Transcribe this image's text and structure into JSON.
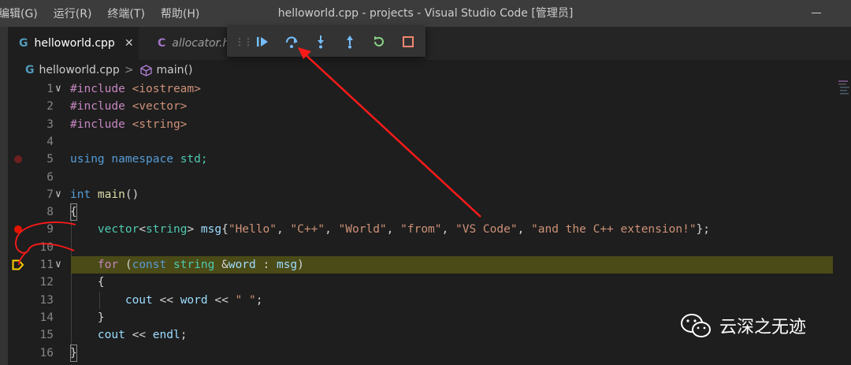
{
  "menu": {
    "items": [
      "编辑(G)",
      "运行(R)",
      "终端(T)",
      "帮助(H)"
    ]
  },
  "window": {
    "title": "helloworld.cpp - projects - Visual Studio Code [管理员]"
  },
  "tabs": [
    {
      "icon": "G",
      "label": "helloworld.cpp",
      "close": "✕",
      "active": true
    },
    {
      "icon": "C",
      "label": "allocator.h",
      "active": false
    }
  ],
  "debug_toolbar": {
    "actions": [
      "continue",
      "step-over",
      "step-into",
      "step-out",
      "restart",
      "stop"
    ]
  },
  "breadcrumb": {
    "file_icon": "G",
    "file": "helloworld.cpp",
    "separator": ">",
    "symbol": "main()"
  },
  "colors": {
    "accent": "#ff2222",
    "current_line": "#4b4b18",
    "breakpoint": "#e51400",
    "debug_arrow": "#ffcc00"
  },
  "editor": {
    "lines": [
      {
        "n": "1",
        "fold": "∨"
      },
      {
        "n": "2"
      },
      {
        "n": "3"
      },
      {
        "n": "4"
      },
      {
        "n": "5",
        "breakpoint": "faded"
      },
      {
        "n": "6"
      },
      {
        "n": "7",
        "fold": "∨"
      },
      {
        "n": "8"
      },
      {
        "n": "9",
        "breakpoint": "active"
      },
      {
        "n": "10"
      },
      {
        "n": "11",
        "fold": "∨",
        "current": true
      },
      {
        "n": "12"
      },
      {
        "n": "13"
      },
      {
        "n": "14"
      },
      {
        "n": "15"
      },
      {
        "n": "16"
      }
    ],
    "code": {
      "l1_kw": "#include",
      "l1_arg": " <iostream>",
      "l2_kw": "#include",
      "l2_arg": " <vector>",
      "l3_kw": "#include",
      "l3_arg": " <string>",
      "l5_using": "using",
      "l5_ns": " namespace",
      "l5_std": " std;",
      "l7_int": "int",
      "l7_main": " main",
      "l7_rest": "()",
      "l8": "{",
      "l9_indent": "    ",
      "l9_vec": "vector",
      "l9_lt": "<",
      "l9_str": "string",
      "l9_gt": "> ",
      "l9_msg": "msg",
      "l9_ob": "{",
      "l9_s1": "\"Hello\"",
      "l9_c1": ", ",
      "l9_s2": "\"C++\"",
      "l9_c2": ", ",
      "l9_s3": "\"World\"",
      "l9_c3": ", ",
      "l9_s4": "\"from\"",
      "l9_c4": ", ",
      "l9_s5": "\"VS Code\"",
      "l9_c5": ", ",
      "l9_s6": "\"and the C++ extension!\"",
      "l9_end": "};",
      "l11_indent": "    ",
      "l11_for": "for",
      "l11_p": " (",
      "l11_const": "const",
      "l11_sp": " ",
      "l11_string": "string",
      "l11_amp": " &",
      "l11_word": "word",
      "l11_colon": " : ",
      "l11_msg": "msg",
      "l11_end": ")",
      "l12": "    {",
      "l13_indent": "        ",
      "l13_cout": "cout",
      "l13_op": " << ",
      "l13_word": "word",
      "l13_op2": " << ",
      "l13_s": "\" \"",
      "l13_end": ";",
      "l14": "    }",
      "l15_indent": "    ",
      "l15_cout": "cout",
      "l15_op": " << ",
      "l15_endl": "endl",
      "l15_end": ";",
      "l16": "}"
    }
  },
  "watermark": {
    "icon": "wechat-icon",
    "text": "云深之无迹"
  }
}
